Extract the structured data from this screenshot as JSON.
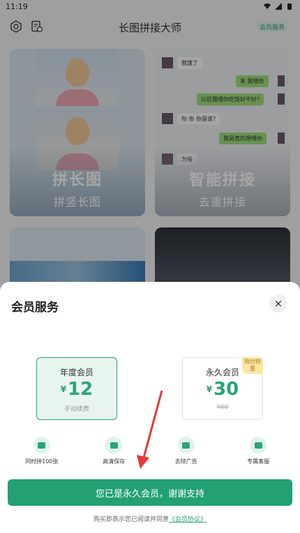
{
  "status": {
    "time": "11:19"
  },
  "header": {
    "title": "长图拼接大师",
    "vip_tag": "会员服务"
  },
  "cards": {
    "long": {
      "title": "拼长图",
      "subtitle": "拼竖长图"
    },
    "smart": {
      "title": "智能拼接",
      "subtitle": "去重拼接",
      "messages": [
        "我饿了",
        "来 我喂你",
        "以后我喂你吃饭好不好?",
        "你 你 你是谁?",
        "我是真的想喂你",
        "为啥"
      ]
    }
  },
  "sheet": {
    "title": "会员服务",
    "close": "×",
    "plans": [
      {
        "name": "年度会员",
        "currency": "¥",
        "price": "12",
        "note": "手动续费"
      },
      {
        "name": "永久会员",
        "currency": "¥",
        "price": "30",
        "note": "¥60",
        "badge": "限时特惠"
      }
    ],
    "features": [
      "同时拼100张",
      "高清保存",
      "去除广告",
      "专属客服"
    ],
    "cta": "您已是永久会员，谢谢支持",
    "agreement_prefix": "购买即表示您已阅读并同意",
    "agreement_link": "《会员协议》"
  },
  "colors": {
    "accent": "#23a173",
    "accent_light": "#e8f5ee",
    "badge": "#fbe7a3",
    "arrow": "#e53935"
  }
}
